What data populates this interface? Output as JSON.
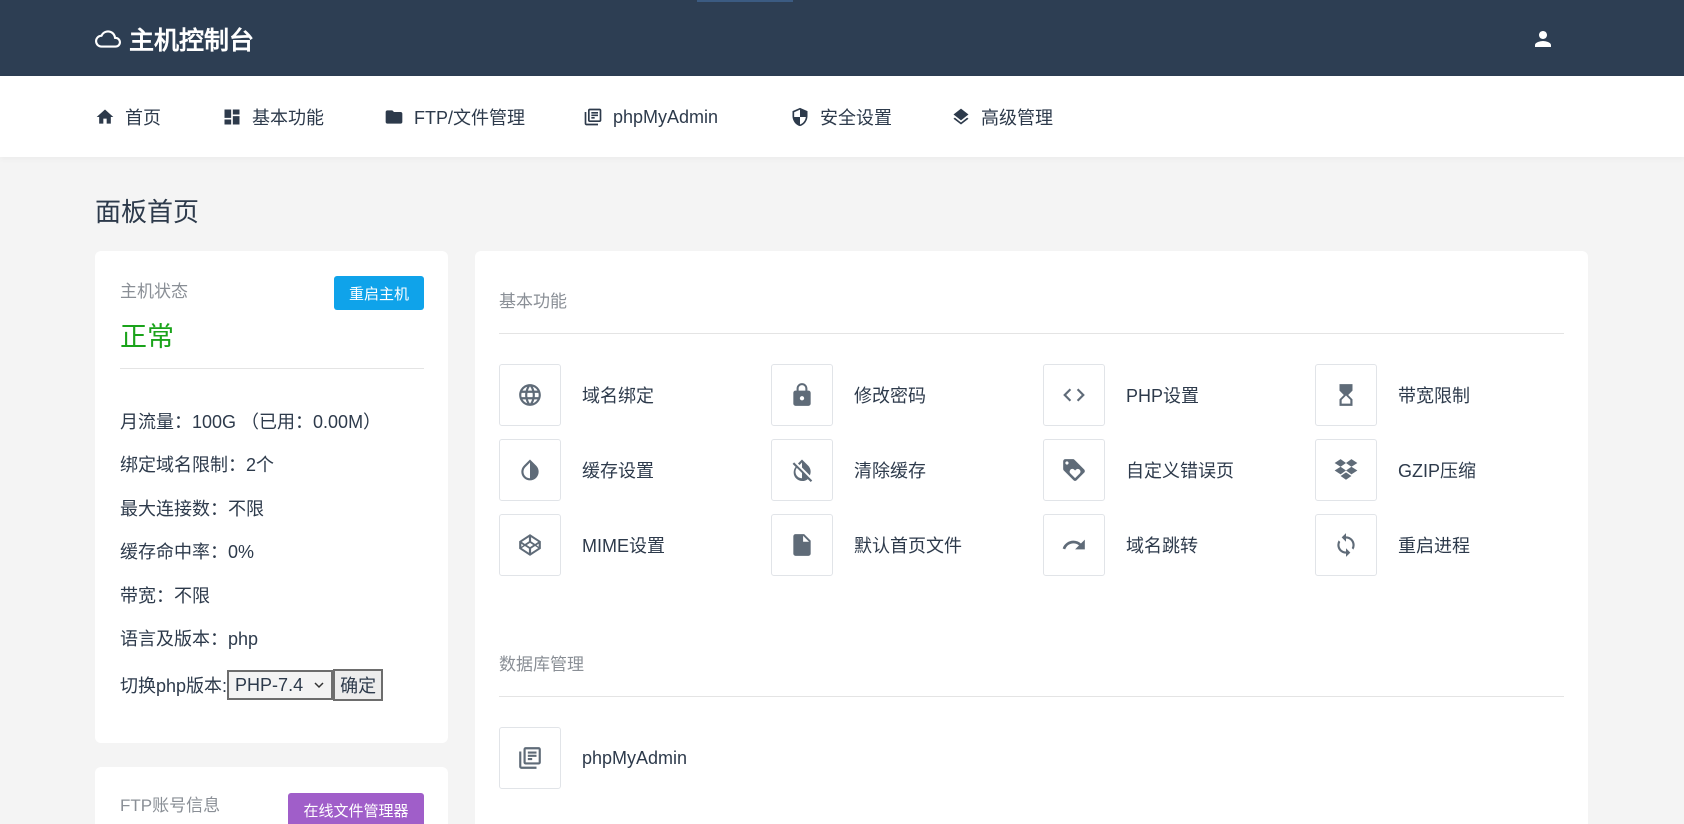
{
  "header": {
    "title": "主机控制台"
  },
  "nav": [
    {
      "label": "首页",
      "icon": "home-icon"
    },
    {
      "label": "基本功能",
      "icon": "dashboard-icon"
    },
    {
      "label": "FTP/文件管理",
      "icon": "folder-icon"
    },
    {
      "label": "phpMyAdmin",
      "icon": "library-icon"
    },
    {
      "label": "安全设置",
      "icon": "shield-icon"
    },
    {
      "label": "高级管理",
      "icon": "layers-icon"
    }
  ],
  "page": {
    "title": "面板首页"
  },
  "host_status": {
    "title": "主机状态",
    "restart_button": "重启主机",
    "status_value": "正常",
    "lines": [
      "月流量：100G （已用：0.00M）",
      "绑定域名限制：2个",
      "最大连接数：不限",
      "缓存命中率：0%",
      "带宽：不限",
      "语言及版本：php"
    ],
    "switch_label": "切换php版本:",
    "php_version": "PHP-7.4",
    "confirm_button": "确定"
  },
  "ftp": {
    "title": "FTP账号信息",
    "file_manager_button": "在线文件管理器"
  },
  "basic_functions": {
    "title": "基本功能",
    "items": [
      {
        "label": "域名绑定",
        "icon": "globe-icon"
      },
      {
        "label": "修改密码",
        "icon": "lock-icon"
      },
      {
        "label": "PHP设置",
        "icon": "code-icon"
      },
      {
        "label": "带宽限制",
        "icon": "hourglass-icon"
      },
      {
        "label": "缓存设置",
        "icon": "contrast-icon"
      },
      {
        "label": "清除缓存",
        "icon": "invert-colors-off-icon"
      },
      {
        "label": "自定义错误页",
        "icon": "tag-heart-icon"
      },
      {
        "label": "GZIP压缩",
        "icon": "dropbox-icon"
      },
      {
        "label": "MIME设置",
        "icon": "codepen-icon"
      },
      {
        "label": "默认首页文件",
        "icon": "file-icon"
      },
      {
        "label": "域名跳转",
        "icon": "redo-icon"
      },
      {
        "label": "重启进程",
        "icon": "sync-icon"
      }
    ]
  },
  "database": {
    "title": "数据库管理",
    "items": [
      {
        "label": "phpMyAdmin",
        "icon": "library-icon"
      }
    ]
  },
  "colors": {
    "header_bg": "#2d3e53",
    "status_ok": "#1aa31a",
    "primary_button": "#0fa3ea",
    "purple_button": "#a05ec9",
    "text": "#2d3a4b"
  }
}
